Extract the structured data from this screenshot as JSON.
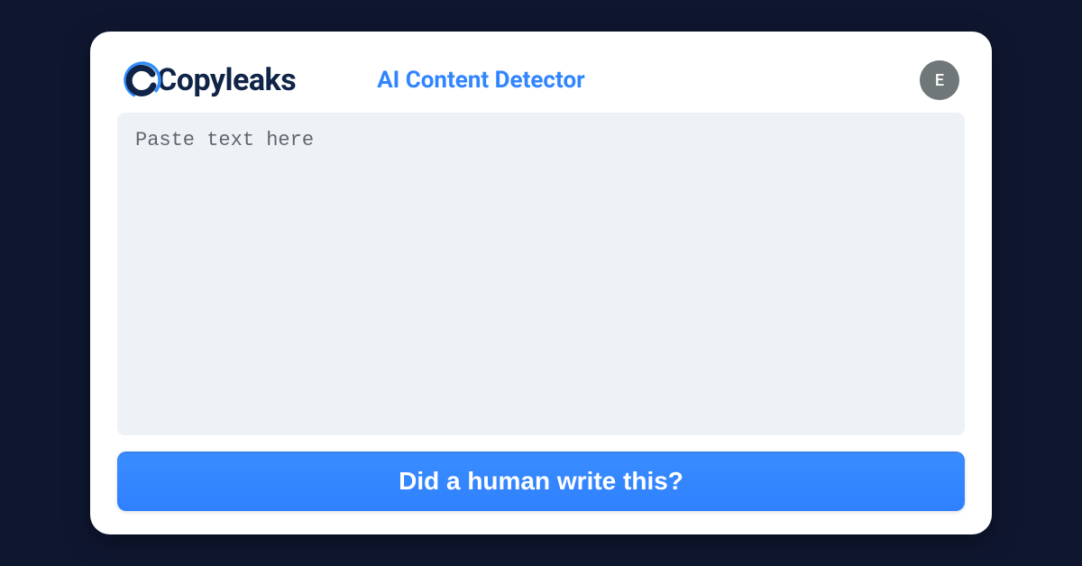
{
  "brand": {
    "name": "Copyleaks"
  },
  "header": {
    "title": "AI Content Detector"
  },
  "avatar": {
    "initial": "E"
  },
  "input": {
    "placeholder": "Paste text here",
    "value": ""
  },
  "actions": {
    "submit_label": "Did a human write this?"
  },
  "colors": {
    "page_bg": "#0f1730",
    "card_bg": "#ffffff",
    "accent": "#3185ff",
    "logo_dark": "#0f2447",
    "input_bg": "#eef2f6",
    "avatar_bg": "#707779"
  }
}
